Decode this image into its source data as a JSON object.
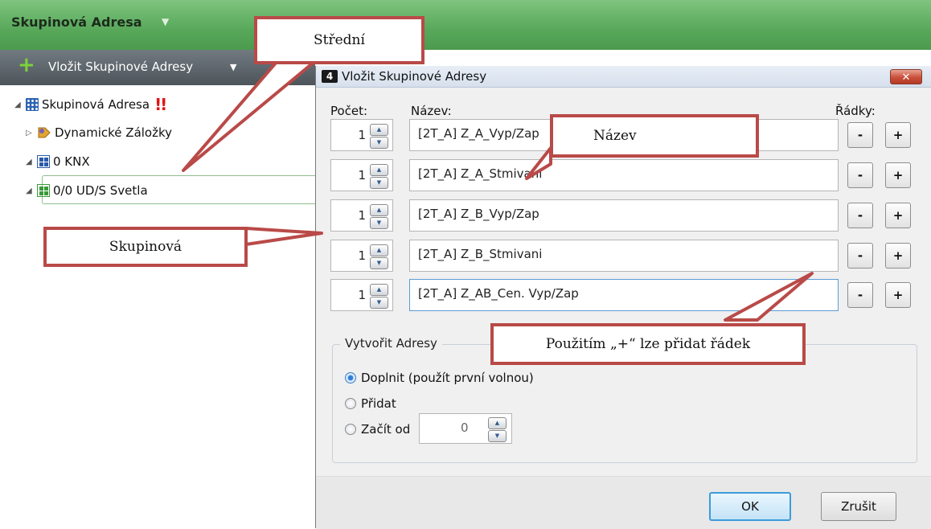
{
  "app": {
    "title": "Skupinová Adresa",
    "toolbar_label": "Vložit Skupinové Adresy",
    "tree": [
      {
        "label": "Skupinová Adresa",
        "icon": "group-address-icon",
        "warning": "!!"
      },
      {
        "label": "Dynamické Záložky",
        "icon": "bookmark-tag-icon"
      },
      {
        "label": "0 KNX",
        "icon": "main-group-icon"
      },
      {
        "label": "0/0 UD/S Svetla",
        "icon": "middle-group-icon"
      }
    ]
  },
  "dialog": {
    "title": "Vložit Skupinové Adresy",
    "close_label": "✕",
    "headers": {
      "count": "Počet:",
      "name": "Název:",
      "rows": "Řádky:"
    },
    "rows": [
      {
        "count": "1",
        "name": "[2T_A] Z_A_Vyp/Zap"
      },
      {
        "count": "1",
        "name": "[2T_A] Z_A_Stmivani"
      },
      {
        "count": "1",
        "name": "[2T_A] Z_B_Vyp/Zap"
      },
      {
        "count": "1",
        "name": "[2T_A] Z_B_Stmivani"
      },
      {
        "count": "1",
        "name": "[2T_A] Z_AB_Cen. Vyp/Zap"
      }
    ],
    "minus_label": "-",
    "plus_label": "+",
    "create_group": {
      "legend": "Vytvořit Adresy",
      "options": [
        {
          "label": "Doplnit (použít první volnou)",
          "selected": true
        },
        {
          "label": "Přidat",
          "selected": false
        },
        {
          "label": "Začít od",
          "selected": false
        }
      ],
      "start_value": "0"
    },
    "ok_label": "OK",
    "cancel_label": "Zrušit"
  },
  "callouts": {
    "stredni": "Střední",
    "nazev": "Název",
    "skupinova": "Skupinová",
    "pridat": "Použitím „+“ lze přidat řádek"
  },
  "colors": {
    "header_green": "#58a85a",
    "callout_border": "#b94a48",
    "warning_red": "#e01515"
  }
}
